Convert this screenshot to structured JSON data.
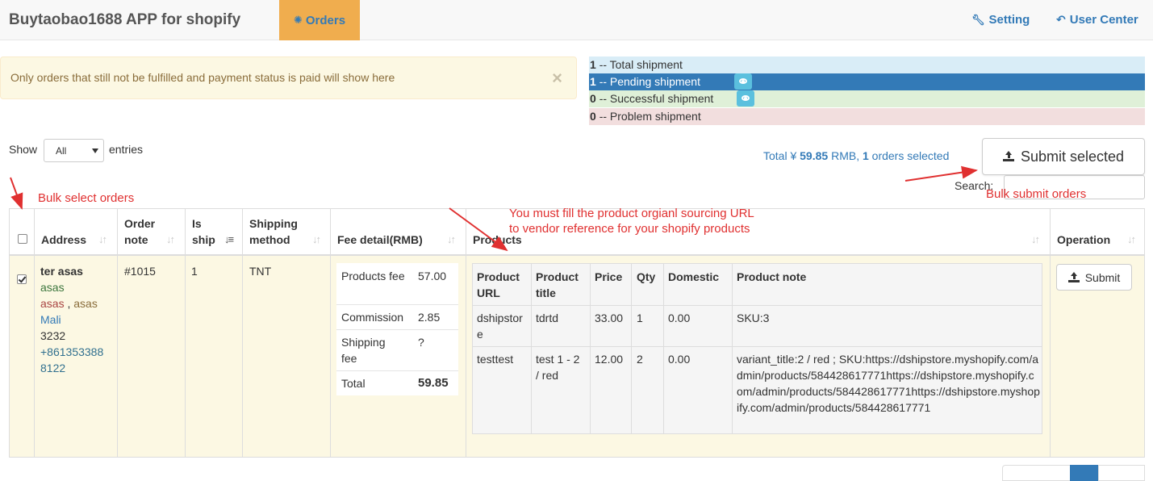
{
  "header": {
    "brand": "Buytaobao1688 APP for shopify",
    "nav_orders": "Orders",
    "setting": "Setting",
    "user_center": "User Center"
  },
  "alert": {
    "text": "Only orders that still not be fulfilled and payment status is paid will show here",
    "close": "×"
  },
  "status_summary": [
    {
      "count": "1",
      "label": "-- Total shipment",
      "color": "#d9edf7",
      "eye": false
    },
    {
      "count": "1",
      "label": "-- Pending shipment",
      "color": "#337ab7",
      "eye": true
    },
    {
      "count": "0",
      "label": "-- Successful shipment",
      "color": "#dff0d8",
      "eye": true
    },
    {
      "count": "0",
      "label": "-- Problem shipment",
      "color": "#f2dede",
      "eye": false
    }
  ],
  "controls": {
    "show_label": "Show",
    "entries_select": "All",
    "entries_label": "entries",
    "total_prefix": "Total ¥",
    "total_amount": "59.85",
    "total_unit": "RMB,",
    "selected_count": "1",
    "selected_suffix": "orders selected",
    "submit_selected": "Submit selected",
    "search_label": "Search:"
  },
  "table": {
    "columns": [
      "Address",
      "Order note",
      "Is ship",
      "Shipping method",
      "Fee detail(RMB)",
      "Products",
      "Operation"
    ],
    "row": {
      "checked": true,
      "address": {
        "name": "ter asas",
        "line1": "asas",
        "line2a": "asas",
        "line2sep": ",",
        "line2b": "asas",
        "country": "Mali",
        "zip": "3232",
        "phone": "+8613533888122"
      },
      "order_note": "#1015",
      "is_ship": "1",
      "shipping_method": "TNT",
      "fees": [
        {
          "label": "Products fee",
          "value": "57.00"
        },
        {
          "label": "Commission",
          "value": "2.85"
        },
        {
          "label": "Shipping fee",
          "value": "?"
        },
        {
          "label": "Total",
          "value": "59.85"
        }
      ],
      "products_header": [
        "Product URL",
        "Product title",
        "Price",
        "Qty",
        "Domestic",
        "Product note"
      ],
      "products": [
        {
          "url": "dshipstore",
          "title": "tdrtd",
          "price": "33.00",
          "qty": "1",
          "domestic": "0.00",
          "note": "SKU:3"
        },
        {
          "url": "testtest",
          "title": "test 1 - 2 / red",
          "price": "12.00",
          "qty": "2",
          "domestic": "0.00",
          "note": "variant_title:2 / red ; SKU:https://dshipstore.myshopify.com/admin/products/584428617771https://dshipstore.myshopify.com/admin/products/584428617771https://dshipstore.myshopify.com/admin/products/584428617771"
        }
      ],
      "operation": "Submit"
    }
  },
  "annotations": {
    "bulk_select": "Bulk select orders",
    "sourcing_line1": "You must fill the product orgianl sourcing URL",
    "sourcing_line2": "to vendor reference for your shopify products",
    "bulk_submit": "Bulk submit orders"
  },
  "colors": {
    "accent": "#337ab7",
    "orders_tab": "#f0ad4e",
    "annotation": "#e03030",
    "row_highlight": "#fcf8e3"
  }
}
